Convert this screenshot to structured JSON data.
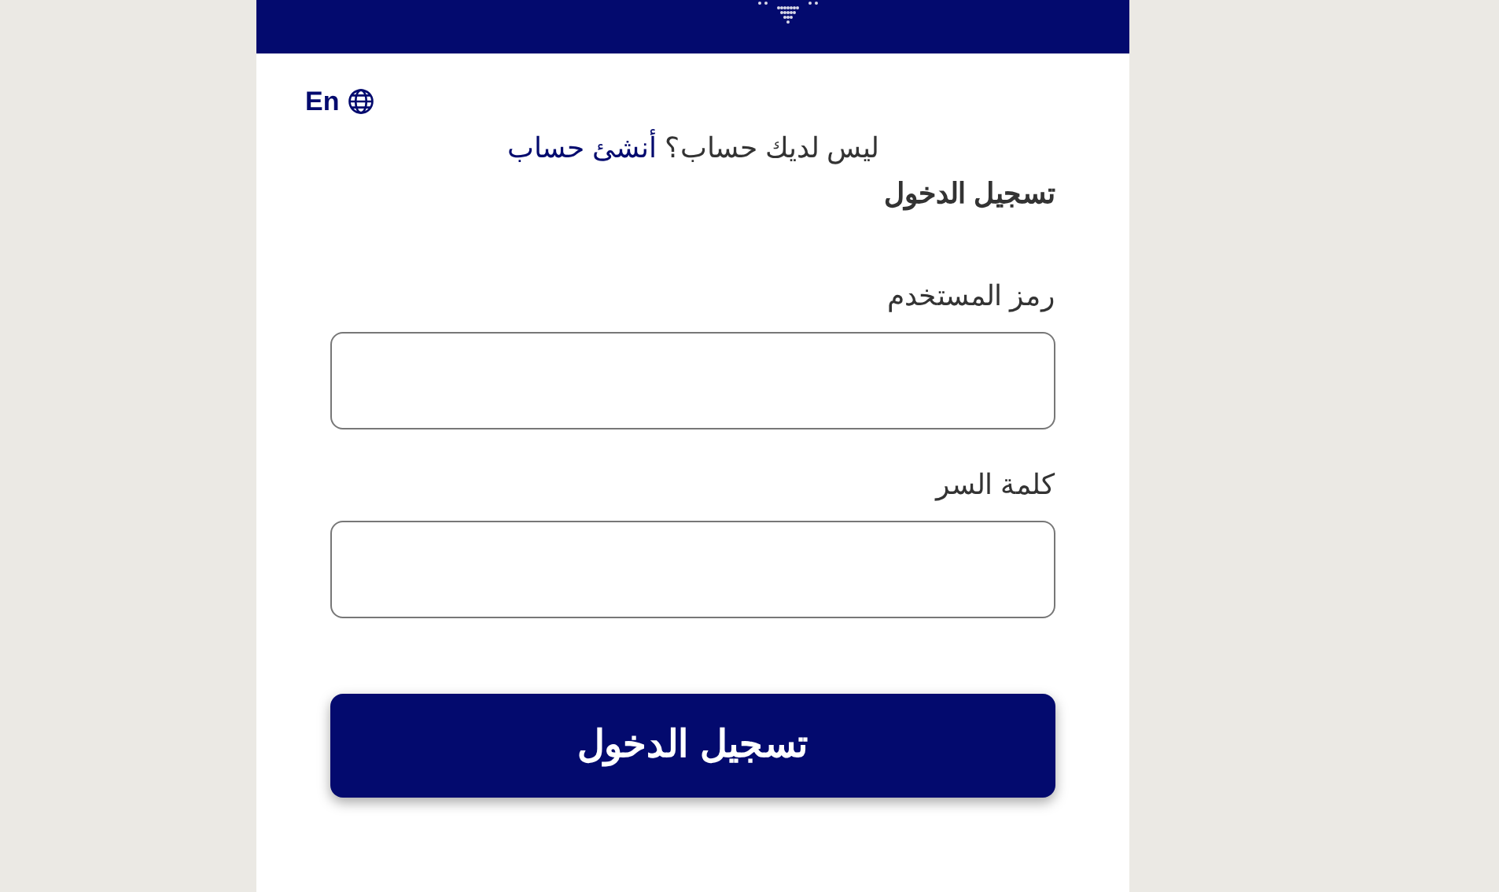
{
  "language_toggle": {
    "label": "En"
  },
  "signup_prompt": {
    "text": "ليس لديك حساب؟",
    "link": "أنشئ حساب"
  },
  "heading": "تسجيل الدخول",
  "fields": [
    {
      "label": "رمز المستخدم"
    },
    {
      "label": "كلمة السر"
    }
  ],
  "submit_button": "تسجيل الدخول"
}
